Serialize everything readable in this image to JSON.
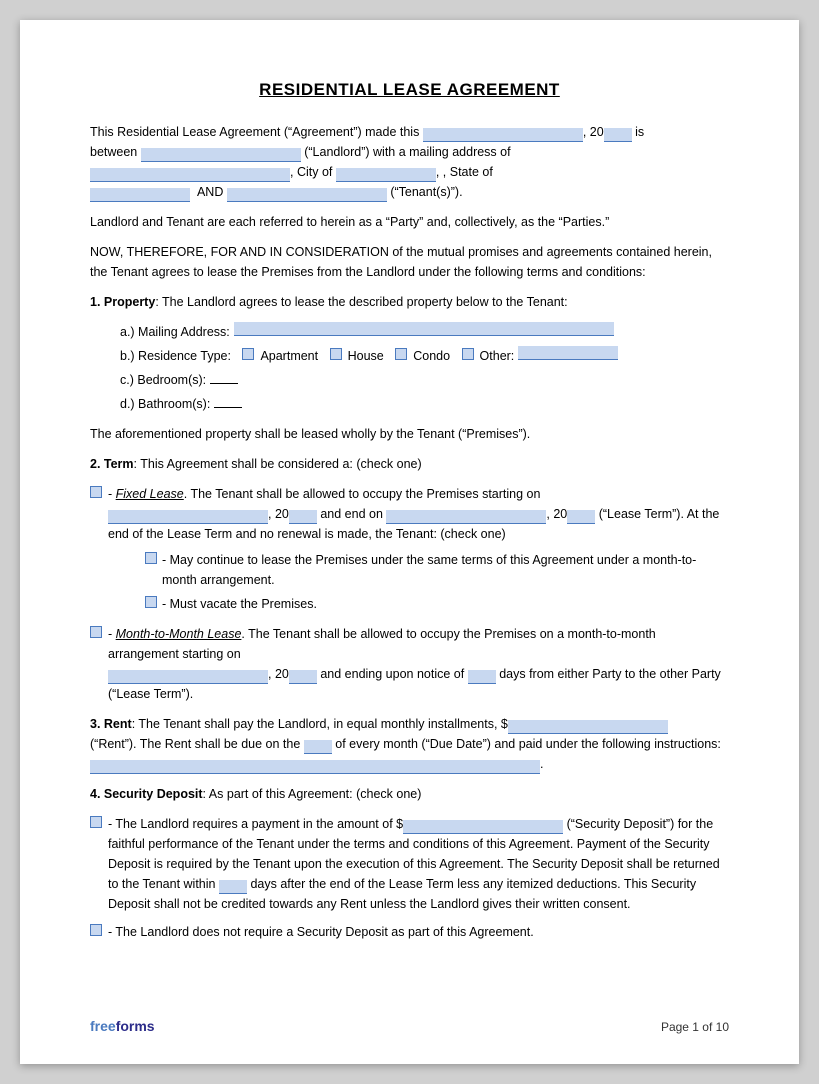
{
  "title": "RESIDENTIAL LEASE AGREEMENT",
  "intro": {
    "line1_a": "This Residential Lease Agreement (“Agreement”) made this",
    "line1_b": ", 20",
    "line1_c": "is",
    "line2_a": "between",
    "line2_b": "(“Landlord”) with a mailing address of",
    "line3_a": ", City of",
    "line3_b": ", State of",
    "line4_a": "AND",
    "line4_b": "(“Tenant(s)”)."
  },
  "parties_note": "Landlord and Tenant are each referred to herein as a “Party” and, collectively, as the “Parties.”",
  "consideration": "NOW, THEREFORE, FOR AND IN CONSIDERATION of the mutual promises and agreements contained herein, the Tenant agrees to lease the Premises from the Landlord under the following terms and conditions:",
  "section1": {
    "title": "1. Property",
    "text": ": The Landlord agrees to lease the described property below to the Tenant:",
    "items": {
      "a_label": "a.)  Mailing Address:",
      "b_label": "b.)  Residence Type:",
      "b_options": [
        "Apartment",
        "House",
        "Condo",
        "Other:"
      ],
      "c_label": "c.)  Bedroom(s):",
      "d_label": "d.)  Bathroom(s):"
    },
    "closing": "The aforementioned property shall be leased wholly by the Tenant (“Premises”)."
  },
  "section2": {
    "title": "2. Term",
    "text": ": This Agreement shall be considered a: (check one)",
    "fixed_lease": {
      "label": "- ",
      "italic": "Fixed Lease",
      "text1": ". The Tenant shall be allowed to occupy the Premises starting on",
      "text2": ", 20",
      "text3": "and end on",
      "text4": ", 20",
      "text5": "(“Lease Term”). At the end of the Lease Term and no renewal is made, the Tenant: (check one)",
      "sub1": "- May continue to lease the Premises under the same terms of this Agreement under a month-to-month arrangement.",
      "sub2": "- Must vacate the Premises."
    },
    "month_lease": {
      "label": "- ",
      "italic": "Month-to-Month Lease",
      "text1": ". The Tenant shall be allowed to occupy the Premises on a month-to-month arrangement starting on",
      "text2": ", 20",
      "text3": "and ending upon notice of",
      "text4": "days from either Party to the other Party (“Lease Term”)."
    }
  },
  "section3": {
    "title": "3. Rent",
    "text1": ": The Tenant shall pay the Landlord, in equal monthly installments, $",
    "text2": "(“Rent”). The Rent shall be due on the",
    "text3": "of every month (“Due Date”) and paid under the following instructions:",
    "suffix": "."
  },
  "section4": {
    "title": "4. Security Deposit",
    "text": ": As part of this Agreement: (check one)",
    "option1_a": "- The Landlord requires a payment in the amount of $",
    "option1_b": "(“Security Deposit”) for the faithful performance of the Tenant under the terms and conditions of this Agreement. Payment of the Security Deposit is required by the Tenant upon the execution of this Agreement. The Security Deposit shall be returned to the Tenant within",
    "option1_c": "days after the end of the Lease Term less any itemized deductions. This Security Deposit shall not be credited towards any Rent unless the Landlord gives their written consent.",
    "option2": "- The Landlord does not require a Security Deposit as part of this Agreement."
  },
  "footer": {
    "brand_free": "free",
    "brand_forms": "forms",
    "page": "Page 1 of 10"
  }
}
